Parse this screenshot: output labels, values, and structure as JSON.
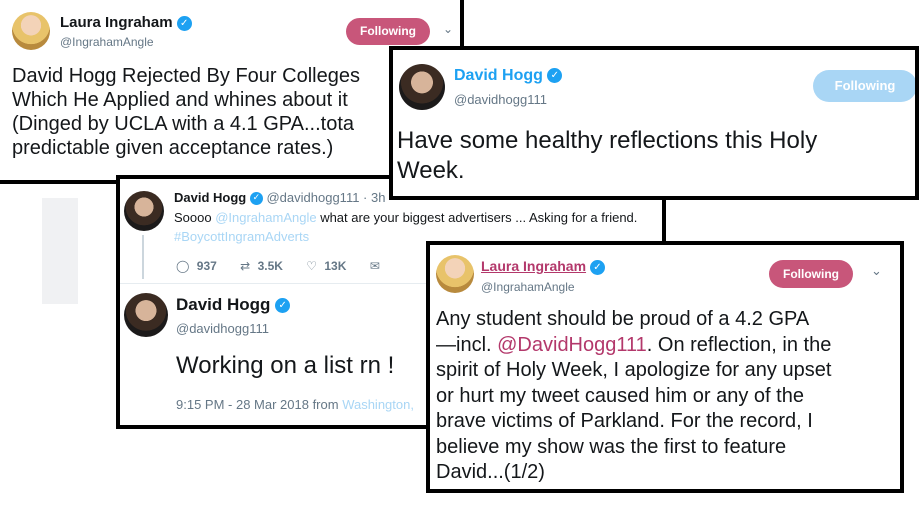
{
  "card1": {
    "name": "Laura Ingraham",
    "handle": "@IngrahamAngle",
    "follow_label": "Following",
    "text_lines": [
      "David Hogg Rejected By Four Colleges",
      "Which He Applied and whines about it",
      "(Dinged by UCLA with a 4.1 GPA...tota",
      "predictable given acceptance rates.)"
    ]
  },
  "card2": {
    "name": "David Hogg",
    "handle": "@davidhogg111",
    "follow_label": "Following",
    "text_lines": [
      "Have some healthy reflections this Holy",
      "Week."
    ]
  },
  "card3": {
    "reply": {
      "name": "David Hogg",
      "handle": "@davidhogg111 · 3h",
      "text_prefix": "Soooo ",
      "mention": "@IngrahamAngle",
      "text_suffix": " what are your biggest advertisers ... Asking for a friend.",
      "hashtag": "#BoycottIngramAdverts",
      "replies": "937",
      "retweets": "3.5K",
      "likes": "13K"
    },
    "main": {
      "name": "David Hogg",
      "handle": "@davidhogg111",
      "text": "Working on a list rn !",
      "timestamp": "9:15 PM - 28 Mar 2018 from ",
      "location": "Washington,"
    }
  },
  "card4": {
    "name": "Laura Ingraham",
    "handle": "@IngrahamAngle",
    "follow_label": "Following",
    "line1": "Any student should be proud of a 4.2 GPA",
    "line2_prefix": "—incl. ",
    "line2_mention": "@DavidHogg111",
    "line2_suffix": ".  On reflection, in the",
    "rest_lines": [
      "spirit of Holy Week, I apologize for any upset",
      "or hurt my tweet caused him or any of the",
      "brave victims of Parkland. For the record, I",
      "believe my show was the first to feature",
      "David...(1/2)"
    ]
  },
  "colors": {
    "follow_pink": "#c8567a",
    "follow_pale_blue": "#a9d6f5",
    "verified": "#1da1f2"
  },
  "icons": [
    "reply-icon",
    "retweet-icon",
    "like-icon",
    "message-icon",
    "chevron-down-icon",
    "verified-icon"
  ]
}
